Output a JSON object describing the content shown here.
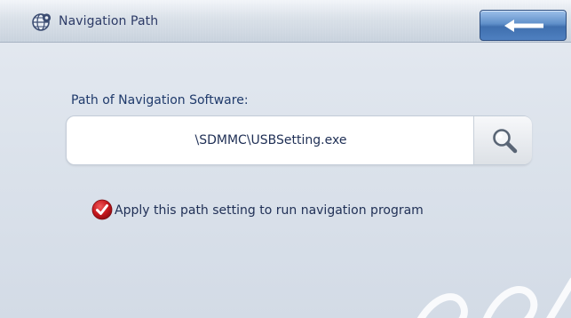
{
  "header": {
    "title": "Navigation Path",
    "icon": "globe-gear-icon",
    "back_icon": "arrow-left-icon"
  },
  "main": {
    "path_label": "Path of Navigation Software:",
    "path_value": "\\SDMMC\\USBSetting.exe",
    "browse_icon": "magnifier-icon",
    "apply_checked": true,
    "apply_label": "Apply this path setting to run navigation program"
  },
  "colors": {
    "title_text": "#2c3a66",
    "accent_blue": "#4e80c0",
    "check_red": "#c4161c"
  }
}
